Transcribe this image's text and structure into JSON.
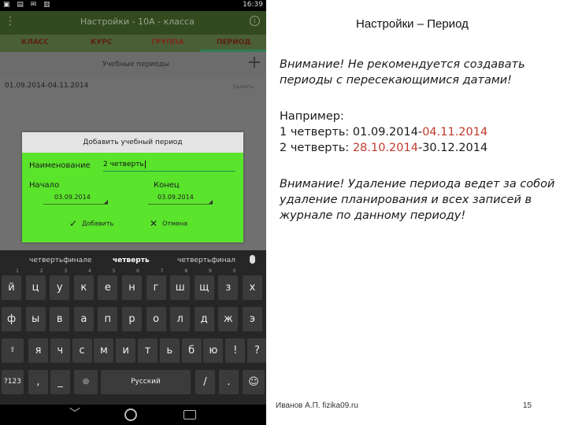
{
  "phone": {
    "status": {
      "time": "16:39"
    },
    "appbar": {
      "title": "Настройки - 10А - класса"
    },
    "tabs": [
      "КЛАСС",
      "КУРС",
      "ГРУППА",
      "ПЕРИОД"
    ],
    "periods_header": "Учебные периоды",
    "period_row": {
      "dates": "01.09.2014-04.11.2014",
      "action": "Удалить"
    },
    "dialog": {
      "title": "Добавить учебный период",
      "name_label": "Наименование",
      "name_value": "2 четверть",
      "start_label": "Начало",
      "start_value": "03.09.2014",
      "end_label": "Конец",
      "end_value": "03.09.2014",
      "ok_label": "Добавить",
      "cancel_label": "Отмена"
    },
    "keyboard": {
      "suggestions": [
        "четвертьфинале",
        "четверть",
        "четвертьфинал"
      ],
      "row1": [
        [
          "й",
          "1"
        ],
        [
          "ц",
          "2"
        ],
        [
          "у",
          "3"
        ],
        [
          "к",
          "4"
        ],
        [
          "е",
          "5"
        ],
        [
          "н",
          "6"
        ],
        [
          "г",
          "7"
        ],
        [
          "ш",
          "8"
        ],
        [
          "щ",
          "9"
        ],
        [
          "з",
          "0"
        ],
        [
          "х",
          ""
        ]
      ],
      "row2": [
        "ф",
        "ы",
        "в",
        "а",
        "п",
        "р",
        "о",
        "л",
        "д",
        "ж",
        "э"
      ],
      "row3": [
        "я",
        "ч",
        "с",
        "м",
        "и",
        "т",
        "ь",
        "б",
        "ю",
        "!",
        "?"
      ],
      "row4": {
        "sym": "?123",
        "comma": ",",
        "dash": "_",
        "space": "Русский",
        "slash": "/",
        "dot": "."
      }
    }
  },
  "slide": {
    "title": "Настройки – Период",
    "warning1": "Внимание! Не рекомендуется создавать периоды с пересекающимися датами!",
    "example_label": "Например:",
    "ex1_prefix": "1 четверть: 01.09.2014-",
    "ex1_red": "04.11.2014",
    "ex2_prefix": "2 четверть: ",
    "ex2_red": "28.10.2014",
    "ex2_suffix": "-30.12.2014",
    "warning2": "Внимание! Удаление периода ведет за собой удаление планирования и всех записей в журнале по данному периоду!",
    "footer_author": "Иванов А.П. fizika09.ru",
    "page_number": "15"
  },
  "colors": {
    "dialog_bg": "#5ae42c",
    "accent_red": "#c0392b",
    "appbar": "#334a1f"
  }
}
